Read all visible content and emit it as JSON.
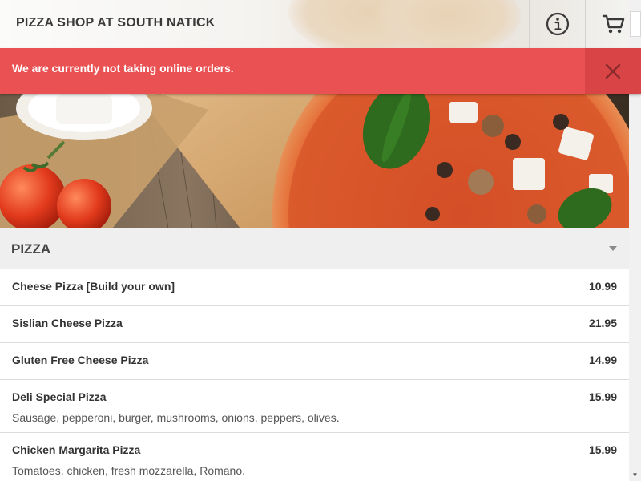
{
  "header": {
    "title": "PIZZA SHOP AT SOUTH NATICK",
    "info_icon": "info-icon",
    "cart_icon": "cart-icon"
  },
  "banner": {
    "message": "We are currently not taking online orders.",
    "close_icon": "close-icon"
  },
  "category": {
    "title": "PIZZA",
    "expand_icon": "caret-down-icon"
  },
  "menu_items": [
    {
      "name": "Cheese Pizza [Build your own]",
      "price": "10.99",
      "description": ""
    },
    {
      "name": "Sislian Cheese Pizza",
      "price": "21.95",
      "description": ""
    },
    {
      "name": "Gluten Free Cheese Pizza",
      "price": "14.99",
      "description": ""
    },
    {
      "name": "Deli Special Pizza",
      "price": "15.99",
      "description": "Sausage, pepperoni, burger, mushrooms, onions, peppers, olives."
    },
    {
      "name": "Chicken Margarita Pizza",
      "price": "15.99",
      "description": "Tomatoes, chicken, fresh mozzarella, Romano."
    }
  ],
  "colors": {
    "banner": "#ea5153",
    "banner_close": "#d94547",
    "category_bg": "#efefef"
  }
}
